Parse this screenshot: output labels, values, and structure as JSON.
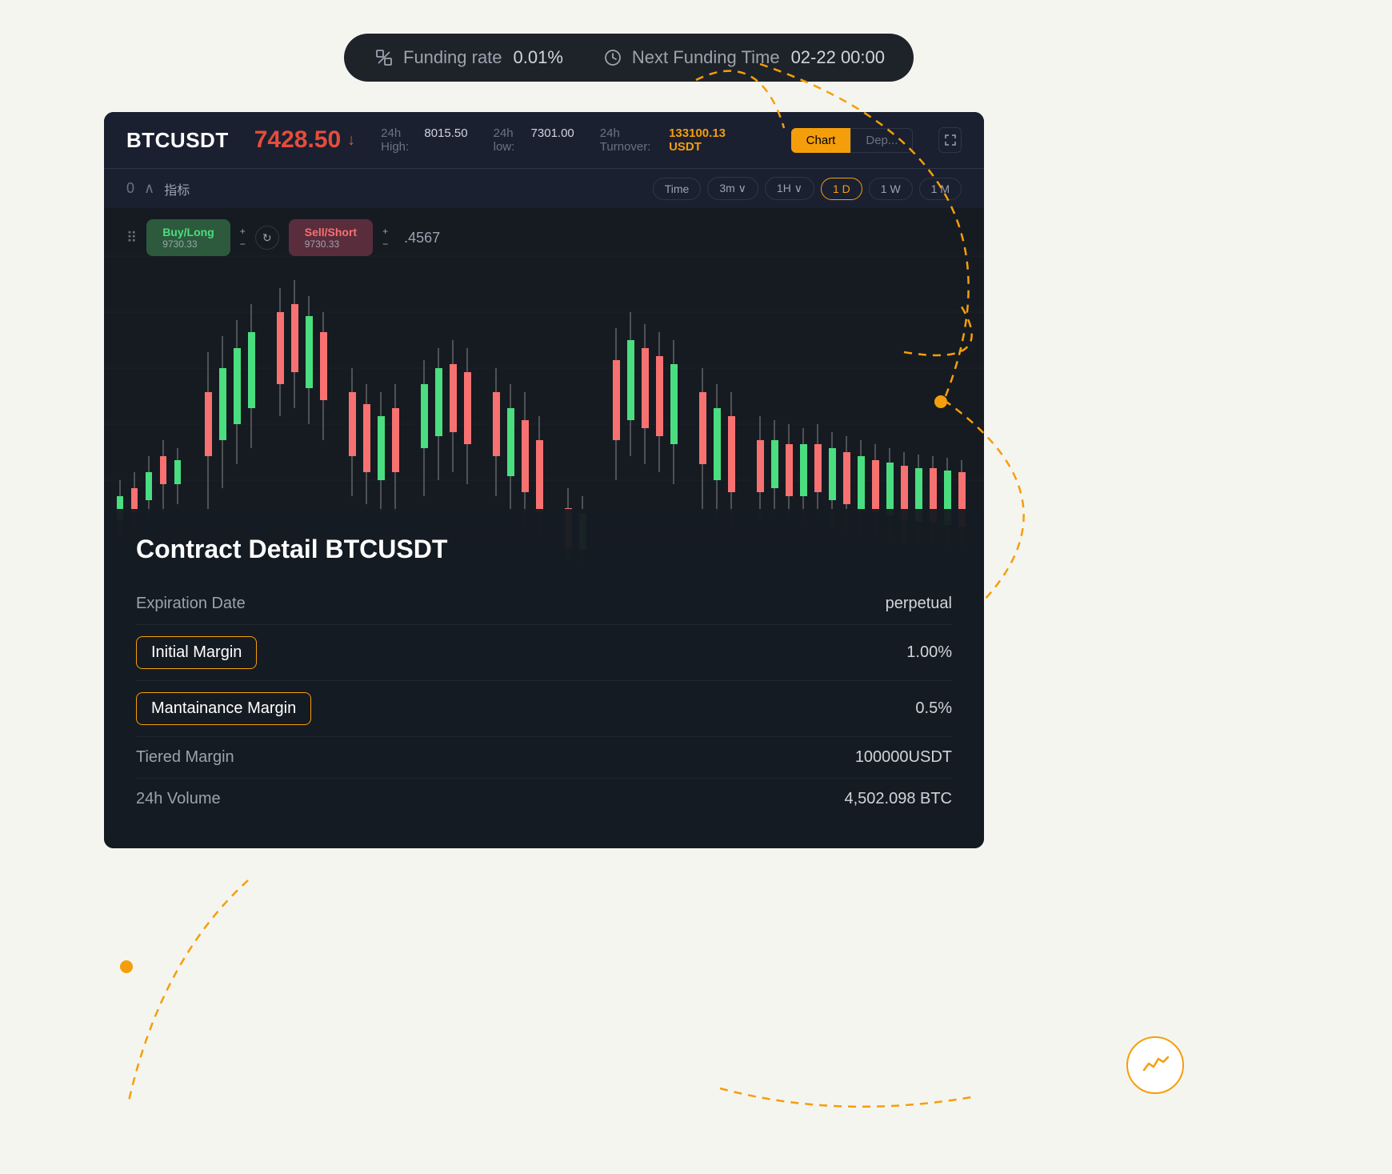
{
  "topBar": {
    "fundingRate": {
      "label": "Funding rate",
      "value": "0.01%",
      "icon": "percent-icon"
    },
    "nextFunding": {
      "label": "Next Funding Time",
      "value": "02-22 00:00",
      "icon": "clock-icon"
    }
  },
  "header": {
    "symbol": "BTCUSDT",
    "price": "7428.50",
    "priceDirection": "down",
    "stats": {
      "high24h": {
        "label": "24h High:",
        "value": "8015.50"
      },
      "low24h": {
        "label": "24h low:",
        "value": "7301.00"
      },
      "turnover24h": {
        "label": "24h Turnover:",
        "value": "133100.13 USDT"
      }
    },
    "tabs": [
      {
        "label": "Chart",
        "active": true
      },
      {
        "label": "Dep...",
        "active": false
      }
    ]
  },
  "indicatorBar": {
    "indicator1": "0↑",
    "indicator2": "∧ 指标"
  },
  "timeSelector": {
    "buttons": [
      {
        "label": "Time",
        "active": false
      },
      {
        "label": "3m",
        "active": false,
        "hasDropdown": true
      },
      {
        "label": "1H",
        "active": false,
        "hasDropdown": true
      },
      {
        "label": "1 D",
        "active": true
      },
      {
        "label": "1 W",
        "active": false
      },
      {
        "label": "1 M",
        "active": false
      }
    ]
  },
  "orderButtons": {
    "buy": {
      "label": "Buy/Long",
      "price": "9730.33",
      "plus": "+",
      "minus": "−"
    },
    "sell": {
      "label": "Sell/Short",
      "price": "9730.33",
      "plus": "+",
      "minus": "−"
    },
    "rightPrice": ".4567"
  },
  "contractDetail": {
    "title": "Contract Detail BTCUSDT",
    "rows": [
      {
        "label": "Expiration Date",
        "value": "perpetual",
        "highlighted": false
      },
      {
        "label": "Initial Margin",
        "value": "1.00%",
        "highlighted": true
      },
      {
        "label": "Mantainance Margin",
        "value": "0.5%",
        "highlighted": true
      },
      {
        "label": "Tiered Margin",
        "value": "100000USDT",
        "highlighted": false
      },
      {
        "label": "24h Volume",
        "value": "4,502.098 BTC",
        "highlighted": false
      }
    ]
  },
  "bottomIcon": {
    "icon": "chart-wave-icon"
  }
}
